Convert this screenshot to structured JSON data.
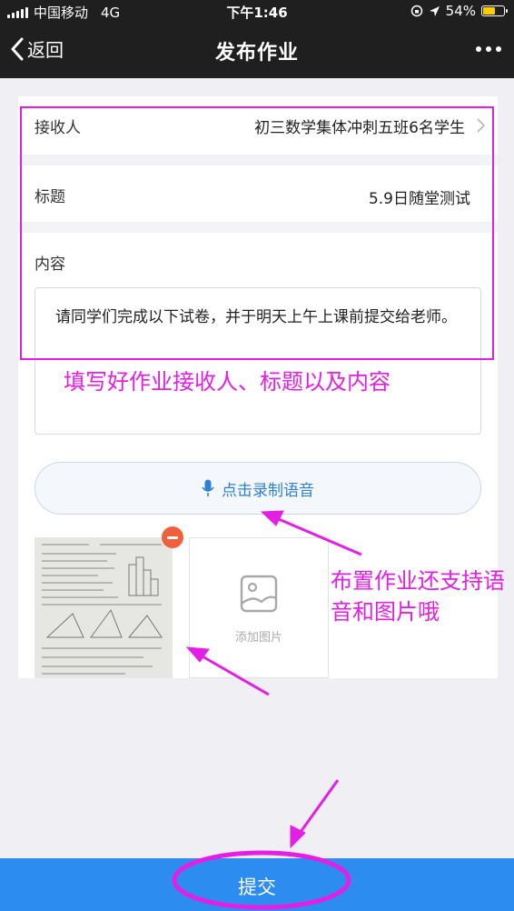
{
  "status_bar": {
    "carrier": "中国移动",
    "network": "4G",
    "time": "下午1:46",
    "battery": "54%",
    "battery_level": 0.54,
    "battery_color": "#ffcc00"
  },
  "nav": {
    "back_label": "返回",
    "title": "发布作业",
    "more_icon": "more-icon"
  },
  "form": {
    "recipient": {
      "label": "接收人",
      "value": "初三数学集体冲刺五班6名学生"
    },
    "title_field": {
      "label": "标题",
      "value": "5.9日随堂测试"
    },
    "content": {
      "label": "内容",
      "value": "请同学们完成以下试卷，并于明天上午上课前提交给老师。"
    },
    "voice_button": "点击录制语音",
    "add_image_label": "添加图片"
  },
  "annotations": {
    "top_note": "填写好作业接收人、标题以及内容",
    "side_note": "布置作业还支持语音和图片哦",
    "color": "#e51ee5"
  },
  "submit_label": "提交",
  "colors": {
    "accent": "#2d8cf0",
    "nav_bg": "#1f1f1f",
    "remove": "#f0603c"
  }
}
